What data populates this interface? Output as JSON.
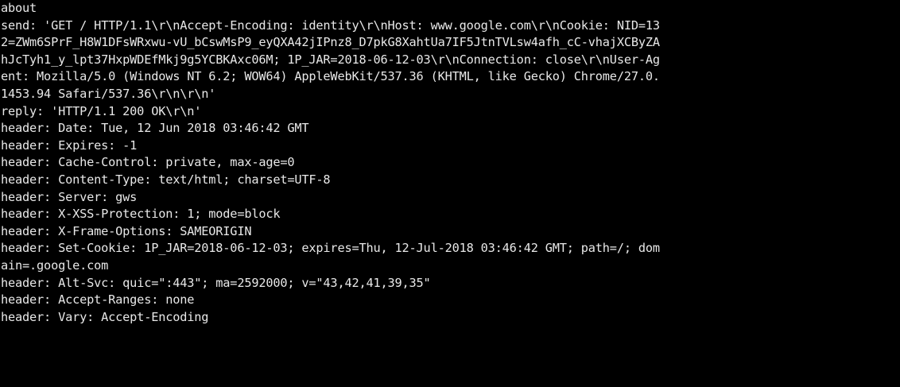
{
  "terminal": {
    "colors": {
      "background": "#000000",
      "foreground": "#e8e8e8"
    },
    "lines": [
      "about",
      "send: 'GET / HTTP/1.1\\r\\nAccept-Encoding: identity\\r\\nHost: www.google.com\\r\\nCookie: NID=13",
      "2=ZWm6SPrF_H8W1DFsWRxwu-vU_bCswMsP9_eyQXA42jIPnz8_D7pkG8XahtUa7IF5JtnTVLsw4afh_cC-vhajXCByZA",
      "hJcTyh1_y_lpt37HxpWDEfMkj9g5YCBKAxc06M; 1P_JAR=2018-06-12-03\\r\\nConnection: close\\r\\nUser-Ag",
      "ent: Mozilla/5.0 (Windows NT 6.2; WOW64) AppleWebKit/537.36 (KHTML, like Gecko) Chrome/27.0.",
      "1453.94 Safari/537.36\\r\\n\\r\\n'",
      "reply: 'HTTP/1.1 200 OK\\r\\n'",
      "header: Date: Tue, 12 Jun 2018 03:46:42 GMT",
      "header: Expires: -1",
      "header: Cache-Control: private, max-age=0",
      "header: Content-Type: text/html; charset=UTF-8",
      "header: Server: gws",
      "header: X-XSS-Protection: 1; mode=block",
      "header: X-Frame-Options: SAMEORIGIN",
      "header: Set-Cookie: 1P_JAR=2018-06-12-03; expires=Thu, 12-Jul-2018 03:46:42 GMT; path=/; dom",
      "ain=.google.com",
      "header: Alt-Svc: quic=\":443\"; ma=2592000; v=\"43,42,41,39,35\"",
      "header: Accept-Ranges: none",
      "header: Vary: Accept-Encoding"
    ]
  }
}
